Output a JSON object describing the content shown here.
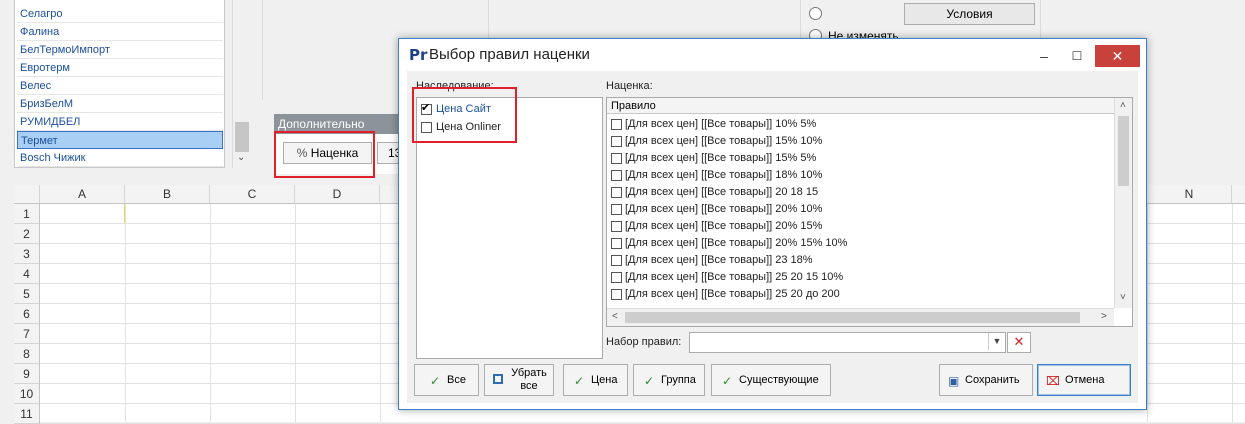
{
  "companies": [
    "Селагро",
    "Фалина",
    "БелТермоИмпорт",
    "Евротерм",
    "Велес",
    "БризБелМ",
    "РУМИДБЕЛ",
    "Термет",
    "Bosch Чижик"
  ],
  "extra_panel": {
    "header": "Дополнительно",
    "markup_button": "Наценка",
    "partial_button": "13"
  },
  "conditions": {
    "button": "Условия",
    "radio_no_change": "Не изменять"
  },
  "sheet": {
    "columns": [
      "A",
      "B",
      "C",
      "D",
      "N"
    ],
    "rows": [
      "1",
      "2",
      "3",
      "4",
      "5",
      "6",
      "7",
      "8",
      "9",
      "10",
      "11"
    ]
  },
  "dialog": {
    "logo": "Pr",
    "title": "Выбор правил наценки",
    "minimize": "–",
    "maximize": "☐",
    "close": "✕",
    "inheritance_label": "Наследование:",
    "inheritance_items": [
      {
        "label": "Цена Сайт",
        "checked": true
      },
      {
        "label": "Цена Onliner",
        "checked": false
      }
    ],
    "markup_label": "Наценка:",
    "grid_header": "Правило",
    "rules": [
      "[Для всех цен] [[Все товары]]  10% 5%",
      "[Для всех цен] [[Все товары]]  15% 10%",
      "[Для всех цен] [[Все товары]]  15% 5%",
      "[Для всех цен] [[Все товары]]  18% 10%",
      "[Для всех цен] [[Все товары]]  20 18 15",
      "[Для всех цен] [[Все товары]]  20% 10%",
      "[Для всех цен] [[Все товары]]  20% 15%",
      "[Для всех цен] [[Все товары]]  20% 15% 10%",
      "[Для всех цен] [[Все товары]]  23 18%",
      "[Для всех цен] [[Все товары]]  25 20 15 10%",
      "[Для всех цен] [[Все товары]]  25 20 до 200"
    ],
    "ruleset_label": "Набор правил:",
    "ruleset_value": "",
    "buttons": {
      "all": "Все",
      "remove_all": "Убрать все",
      "price": "Цена",
      "group": "Группа",
      "existing": "Существующие",
      "save": "Сохранить",
      "cancel": "Отмена"
    }
  },
  "colors": {
    "highlight": "#e0202a",
    "link_text": "#1b4f9c",
    "dialog_border": "#3c7fc9",
    "close_button": "#c8413a"
  }
}
